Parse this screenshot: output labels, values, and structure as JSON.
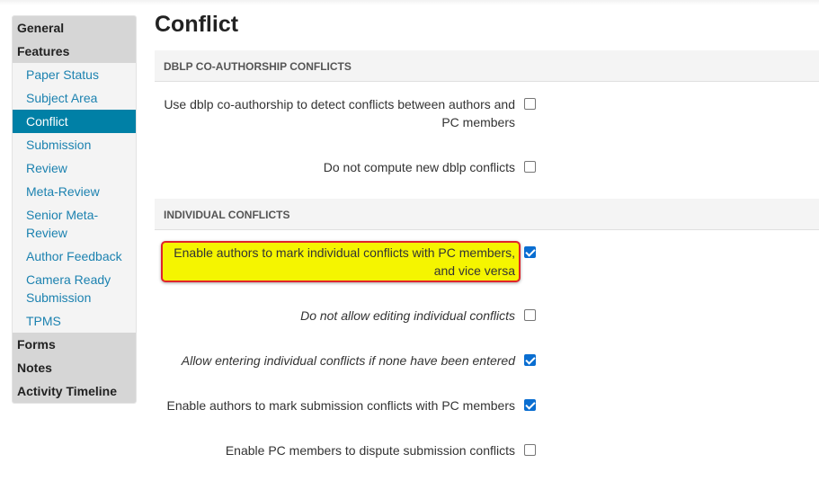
{
  "sidebar": {
    "groups": [
      {
        "label": "General"
      },
      {
        "label": "Features"
      }
    ],
    "feature_items": [
      {
        "label": "Paper Status"
      },
      {
        "label": "Subject Area"
      },
      {
        "label": "Conflict",
        "active": true
      },
      {
        "label": "Submission"
      },
      {
        "label": "Review"
      },
      {
        "label": "Meta-Review"
      },
      {
        "label": "Senior Meta-Review"
      },
      {
        "label": "Author Feedback"
      },
      {
        "label": "Camera Ready Submission"
      },
      {
        "label": "TPMS"
      }
    ],
    "bottom_groups": [
      {
        "label": "Forms"
      },
      {
        "label": "Notes"
      },
      {
        "label": "Activity Timeline"
      }
    ]
  },
  "main": {
    "title": "Conflict",
    "sections": [
      {
        "heading": "DBLP CO-AUTHORSHIP CONFLICTS",
        "options": [
          {
            "label": "Use dblp co-authorship to detect conflicts between authors and PC members",
            "checked": false,
            "italic": false
          },
          {
            "label": "Do not compute new dblp conflicts",
            "checked": false,
            "italic": false
          }
        ]
      },
      {
        "heading": "INDIVIDUAL CONFLICTS",
        "options": [
          {
            "label": "Enable authors to mark individual conflicts with PC members, and vice versa",
            "checked": true,
            "italic": false,
            "highlighted": true
          },
          {
            "label": "Do not allow editing individual conflicts",
            "checked": false,
            "italic": true
          },
          {
            "label": "Allow entering individual conflicts if none have been entered",
            "checked": true,
            "italic": true
          },
          {
            "label": "Enable authors to mark submission conflicts with PC members",
            "checked": true,
            "italic": false
          },
          {
            "label": "Enable PC members to dispute submission conflicts",
            "checked": false,
            "italic": false
          }
        ]
      }
    ]
  },
  "colors": {
    "accent": "#0080a6",
    "link": "#1c82b0",
    "highlight": "#f5f500",
    "highlight_border": "#e0242b",
    "checkbox_checked": "#0a6ed1"
  }
}
